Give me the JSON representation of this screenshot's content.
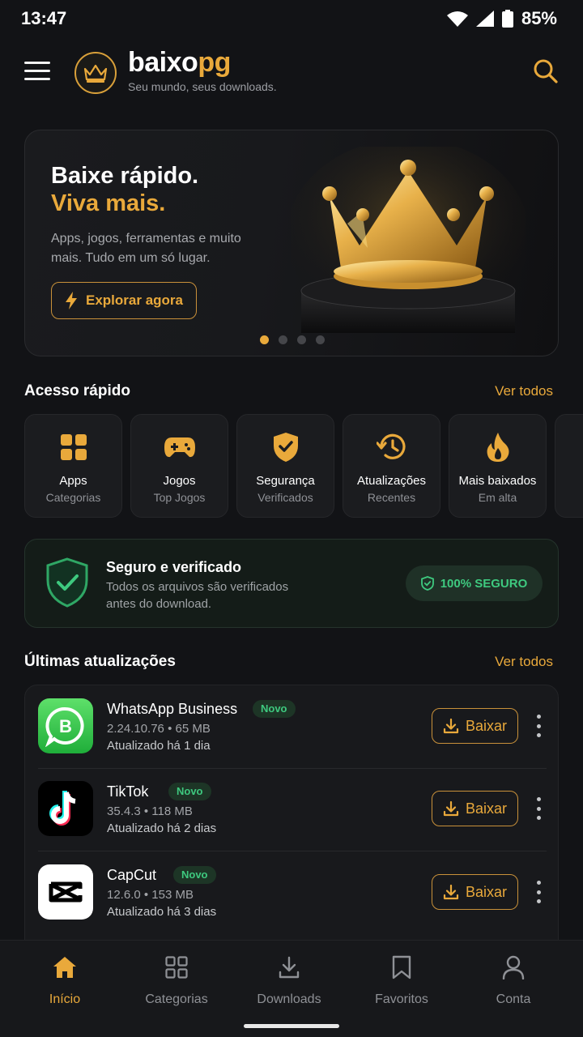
{
  "status": {
    "time": "13:47",
    "battery": "85%"
  },
  "header": {
    "brand_part1": "baixo",
    "brand_part2": "pg",
    "tagline": "Seu mundo, seus downloads."
  },
  "hero": {
    "title_line1": "Baixe rápido.",
    "title_line2": "Viva mais.",
    "description": "Apps, jogos, ferramentas e muito mais. Tudo em um só lugar.",
    "button_label": "Explorar agora",
    "active_slide": 1,
    "slide_count": 4
  },
  "quick_access": {
    "title": "Acesso rápido",
    "see_all": "Ver todos",
    "items": [
      {
        "label": "Apps",
        "sub": "Categorias",
        "icon": "grid-icon"
      },
      {
        "label": "Jogos",
        "sub": "Top Jogos",
        "icon": "gamepad-icon"
      },
      {
        "label": "Segurança",
        "sub": "Verificados",
        "icon": "shield-check-icon"
      },
      {
        "label": "Atualizações",
        "sub": "Recentes",
        "icon": "history-icon"
      },
      {
        "label": "Mais baixados",
        "sub": "Em alta",
        "icon": "flame-icon"
      }
    ]
  },
  "security": {
    "title": "Seguro e verificado",
    "description": "Todos os arquivos são verificados antes do download.",
    "badge": "100% SEGURO"
  },
  "updates": {
    "title": "Últimas atualizações",
    "see_all": "Ver todos",
    "apps": [
      {
        "name": "WhatsApp Business",
        "tag": "Novo",
        "meta": "2.24.10.76 • 65 MB",
        "updated": "Atualizado há 1 dia",
        "button": "Baixar",
        "icon": "whatsapp-business-icon"
      },
      {
        "name": "TikTok",
        "tag": "Novo",
        "meta": "35.4.3 • 118 MB",
        "updated": "Atualizado há 2 dias",
        "button": "Baixar",
        "icon": "tiktok-icon"
      },
      {
        "name": "CapCut",
        "tag": "Novo",
        "meta": "12.6.0 • 153 MB",
        "updated": "Atualizado há 3 dias",
        "button": "Baixar",
        "icon": "capcut-icon"
      }
    ]
  },
  "bottom_nav": {
    "items": [
      {
        "label": "Início",
        "icon": "home-icon",
        "active": true
      },
      {
        "label": "Categorias",
        "icon": "grid-outline-icon",
        "active": false
      },
      {
        "label": "Downloads",
        "icon": "download-icon",
        "active": false
      },
      {
        "label": "Favoritos",
        "icon": "bookmark-icon",
        "active": false
      },
      {
        "label": "Conta",
        "icon": "user-icon",
        "active": false
      }
    ]
  },
  "colors": {
    "accent": "#e9a93b",
    "success": "#3ec97f",
    "background": "#121316"
  }
}
